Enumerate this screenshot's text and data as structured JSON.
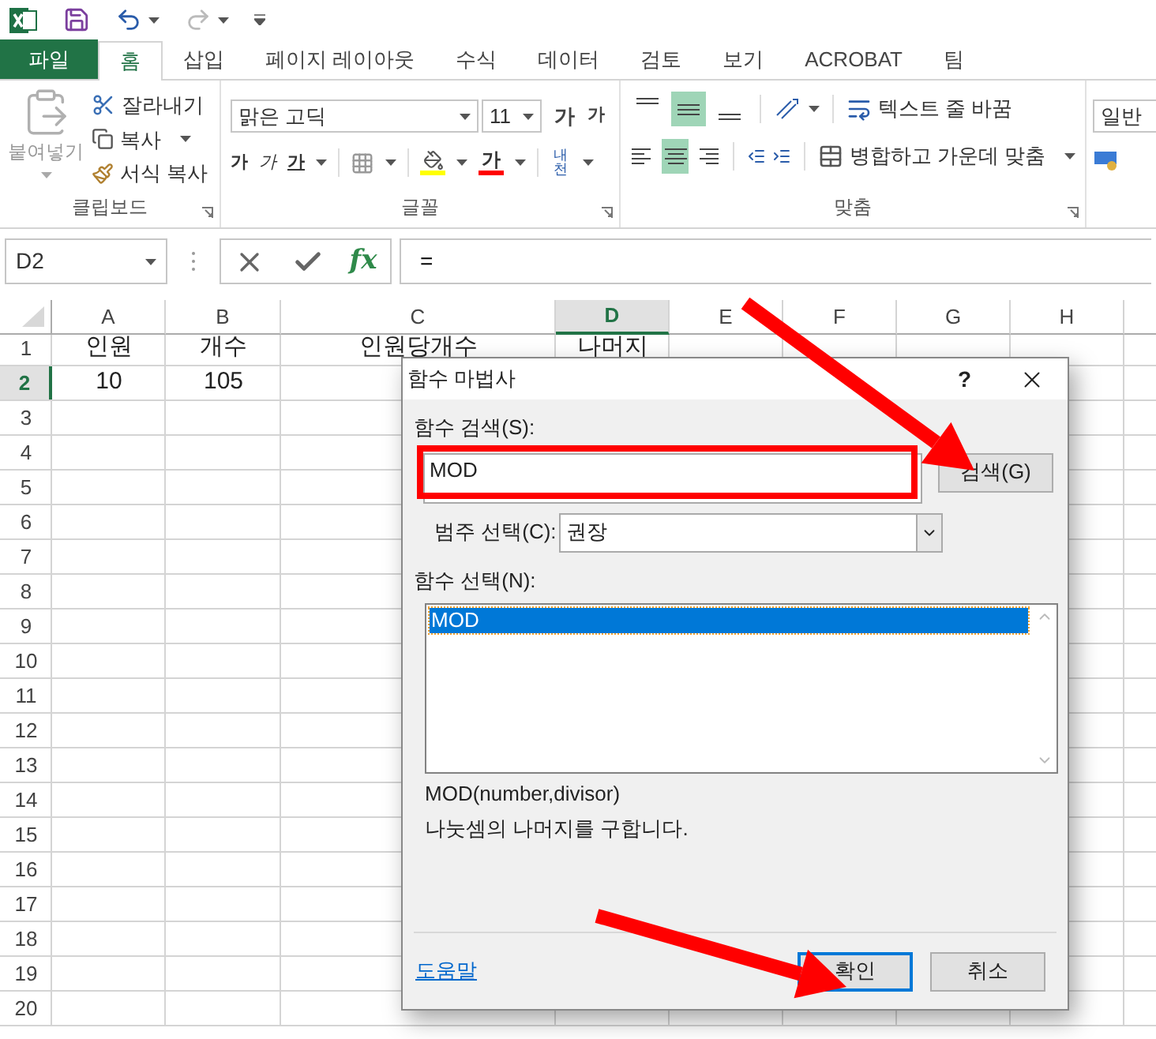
{
  "tabs": [
    {
      "label": "파일",
      "kind": "file",
      "selected": false
    },
    {
      "label": "홈",
      "kind": "tab",
      "selected": true
    },
    {
      "label": "삽입",
      "kind": "tab",
      "selected": false
    },
    {
      "label": "페이지 레이아웃",
      "kind": "tab",
      "selected": false
    },
    {
      "label": "수식",
      "kind": "tab",
      "selected": false
    },
    {
      "label": "데이터",
      "kind": "tab",
      "selected": false
    },
    {
      "label": "검토",
      "kind": "tab",
      "selected": false
    },
    {
      "label": "보기",
      "kind": "tab",
      "selected": false
    },
    {
      "label": "ACROBAT",
      "kind": "tab",
      "selected": false
    },
    {
      "label": "팀",
      "kind": "tab",
      "selected": false
    }
  ],
  "ribbon": {
    "clipboard": {
      "label": "클립보드",
      "paste": "붙여넣기",
      "cut": "잘라내기",
      "copy": "복사",
      "format_painter": "서식 복사"
    },
    "font": {
      "label": "글꼴",
      "font_name": "맑은 고딕",
      "font_size": "11",
      "size_buttons": [
        {
          "label": "가",
          "kind": "grow"
        },
        {
          "label": "가",
          "kind": "shrink"
        }
      ],
      "style_buttons": [
        {
          "label": "가",
          "kind": "bold"
        },
        {
          "label": "가",
          "kind": "italic"
        },
        {
          "label": "가",
          "kind": "underline"
        }
      ],
      "font_color": "가",
      "phonetic": "내천"
    },
    "alignment": {
      "label": "맞춤",
      "vertical": [
        {
          "kind": "top",
          "selected": false
        },
        {
          "kind": "middle",
          "selected": true
        },
        {
          "kind": "bottom",
          "selected": false
        }
      ],
      "horizontal": [
        {
          "kind": "left",
          "selected": false
        },
        {
          "kind": "center",
          "selected": true
        },
        {
          "kind": "right",
          "selected": false
        }
      ],
      "wrap_text": "텍스트 줄 바꿈",
      "merge": "병합하고 가운데 맞춤"
    },
    "number": {
      "format": "일반"
    }
  },
  "formula_bar": {
    "name_box": "D2",
    "fx": "fx",
    "formula": "="
  },
  "sheet": {
    "columns": [
      {
        "label": "A",
        "selected": false
      },
      {
        "label": "B",
        "selected": false
      },
      {
        "label": "C",
        "selected": false
      },
      {
        "label": "D",
        "selected": true
      },
      {
        "label": "E",
        "selected": false
      },
      {
        "label": "F",
        "selected": false
      },
      {
        "label": "G",
        "selected": false
      },
      {
        "label": "H",
        "selected": false
      }
    ],
    "rows": [
      {
        "number": "1",
        "selected": false,
        "cells": [
          "인원",
          "개수",
          "인원당개수",
          "나머지"
        ]
      },
      {
        "number": "2",
        "selected": true,
        "cells": [
          "10",
          "105"
        ]
      },
      {
        "number": "3",
        "selected": false
      },
      {
        "number": "4",
        "selected": false
      },
      {
        "number": "5",
        "selected": false
      },
      {
        "number": "6",
        "selected": false
      },
      {
        "number": "7",
        "selected": false
      },
      {
        "number": "8",
        "selected": false
      },
      {
        "number": "9",
        "selected": false
      },
      {
        "number": "10",
        "selected": false
      },
      {
        "number": "11",
        "selected": false
      },
      {
        "number": "12",
        "selected": false
      },
      {
        "number": "13",
        "selected": false
      },
      {
        "number": "14",
        "selected": false
      },
      {
        "number": "15",
        "selected": false
      },
      {
        "number": "16",
        "selected": false
      },
      {
        "number": "17",
        "selected": false
      },
      {
        "number": "18",
        "selected": false
      },
      {
        "number": "19",
        "selected": false
      },
      {
        "number": "20",
        "selected": false
      }
    ]
  },
  "dialog": {
    "title": "함수 마법사",
    "help": "?",
    "search_label": "함수 검색(S):",
    "search_value": "MOD",
    "search_button": "검색(G)",
    "category_label": "범주 선택(C):",
    "category_value": "권장",
    "function_label": "함수 선택(N):",
    "functions": [
      {
        "label": "MOD",
        "selected": true
      }
    ],
    "signature": "MOD(number,divisor)",
    "description": "나눗셈의 나머지를 구합니다.",
    "help_link": "도움말",
    "ok": "확인",
    "cancel": "취소"
  }
}
